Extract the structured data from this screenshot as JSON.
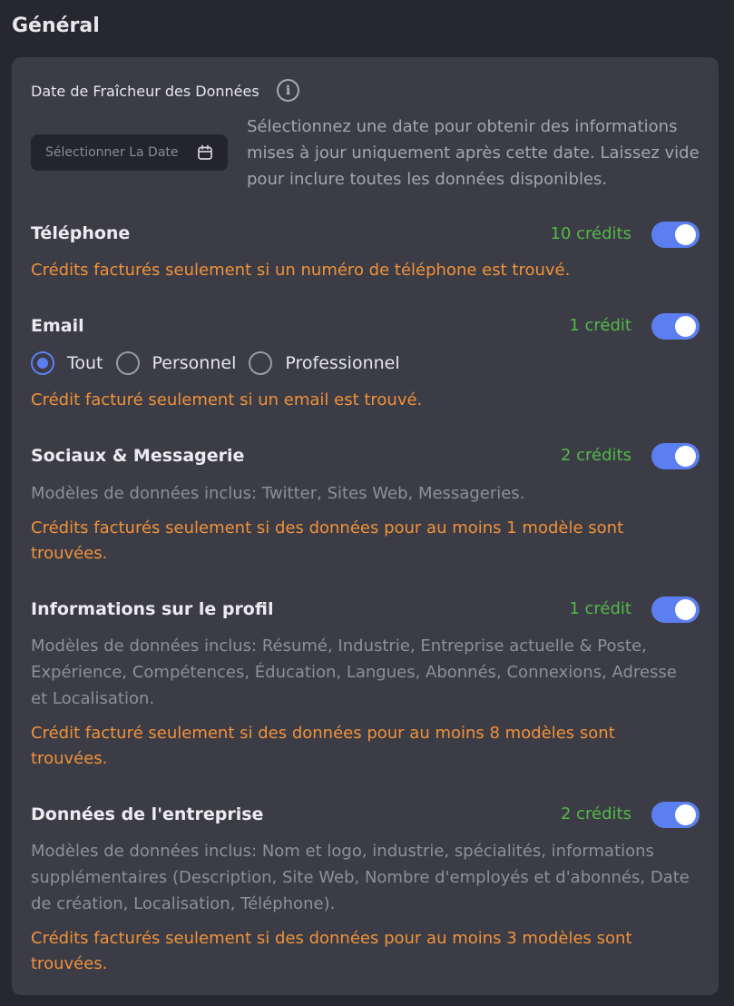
{
  "section_title": "Général",
  "date": {
    "label": "Date de Fraîcheur des Données",
    "placeholder": "Sélectionner La Date",
    "help": "Sélectionnez une date pour obtenir des informations mises à jour uniquement après cette date. Laissez vide pour inclure toutes les données disponibles."
  },
  "options": [
    {
      "title": "Téléphone",
      "credits": "10 crédits",
      "enabled": true,
      "warning": "Crédits facturés seulement si un numéro de téléphone est trouvé."
    },
    {
      "title": "Email",
      "credits": "1 crédit",
      "enabled": true,
      "radios": [
        "Tout",
        "Personnel",
        "Professionnel"
      ],
      "selected": "Tout",
      "warning": "Crédit facturé seulement si un email est trouvé."
    },
    {
      "title": "Sociaux & Messagerie",
      "credits": "2 crédits",
      "enabled": true,
      "models": "Modèles de données inclus: Twitter, Sites Web, Messageries.",
      "warning": "Crédits facturés seulement si des données pour au moins 1 modèle sont trouvées."
    },
    {
      "title": "Informations sur le profil",
      "credits": "1 crédit",
      "enabled": true,
      "models": "Modèles de données inclus: Résumé, Industrie, Entreprise actuelle & Poste, Expérience, Compétences, Éducation, Langues, Abonnés, Connexions, Adresse et Localisation.",
      "warning": "Crédit facturé seulement si des données pour au moins 8 modèles sont trouvées."
    },
    {
      "title": "Données de l'entreprise",
      "credits": "2 crédits",
      "enabled": true,
      "models": "Modèles de données inclus: Nom et logo, industrie, spécialités, informations supplémentaires (Description, Site Web, Nombre d'employés et d'abonnés, Date de création, Localisation, Téléphone).",
      "warning": "Crédits facturés seulement si des données pour au moins 3 modèles sont trouvées."
    }
  ],
  "colors": {
    "accent": "#5b7ff0",
    "credits": "#54b948",
    "warning": "#f0923b"
  }
}
